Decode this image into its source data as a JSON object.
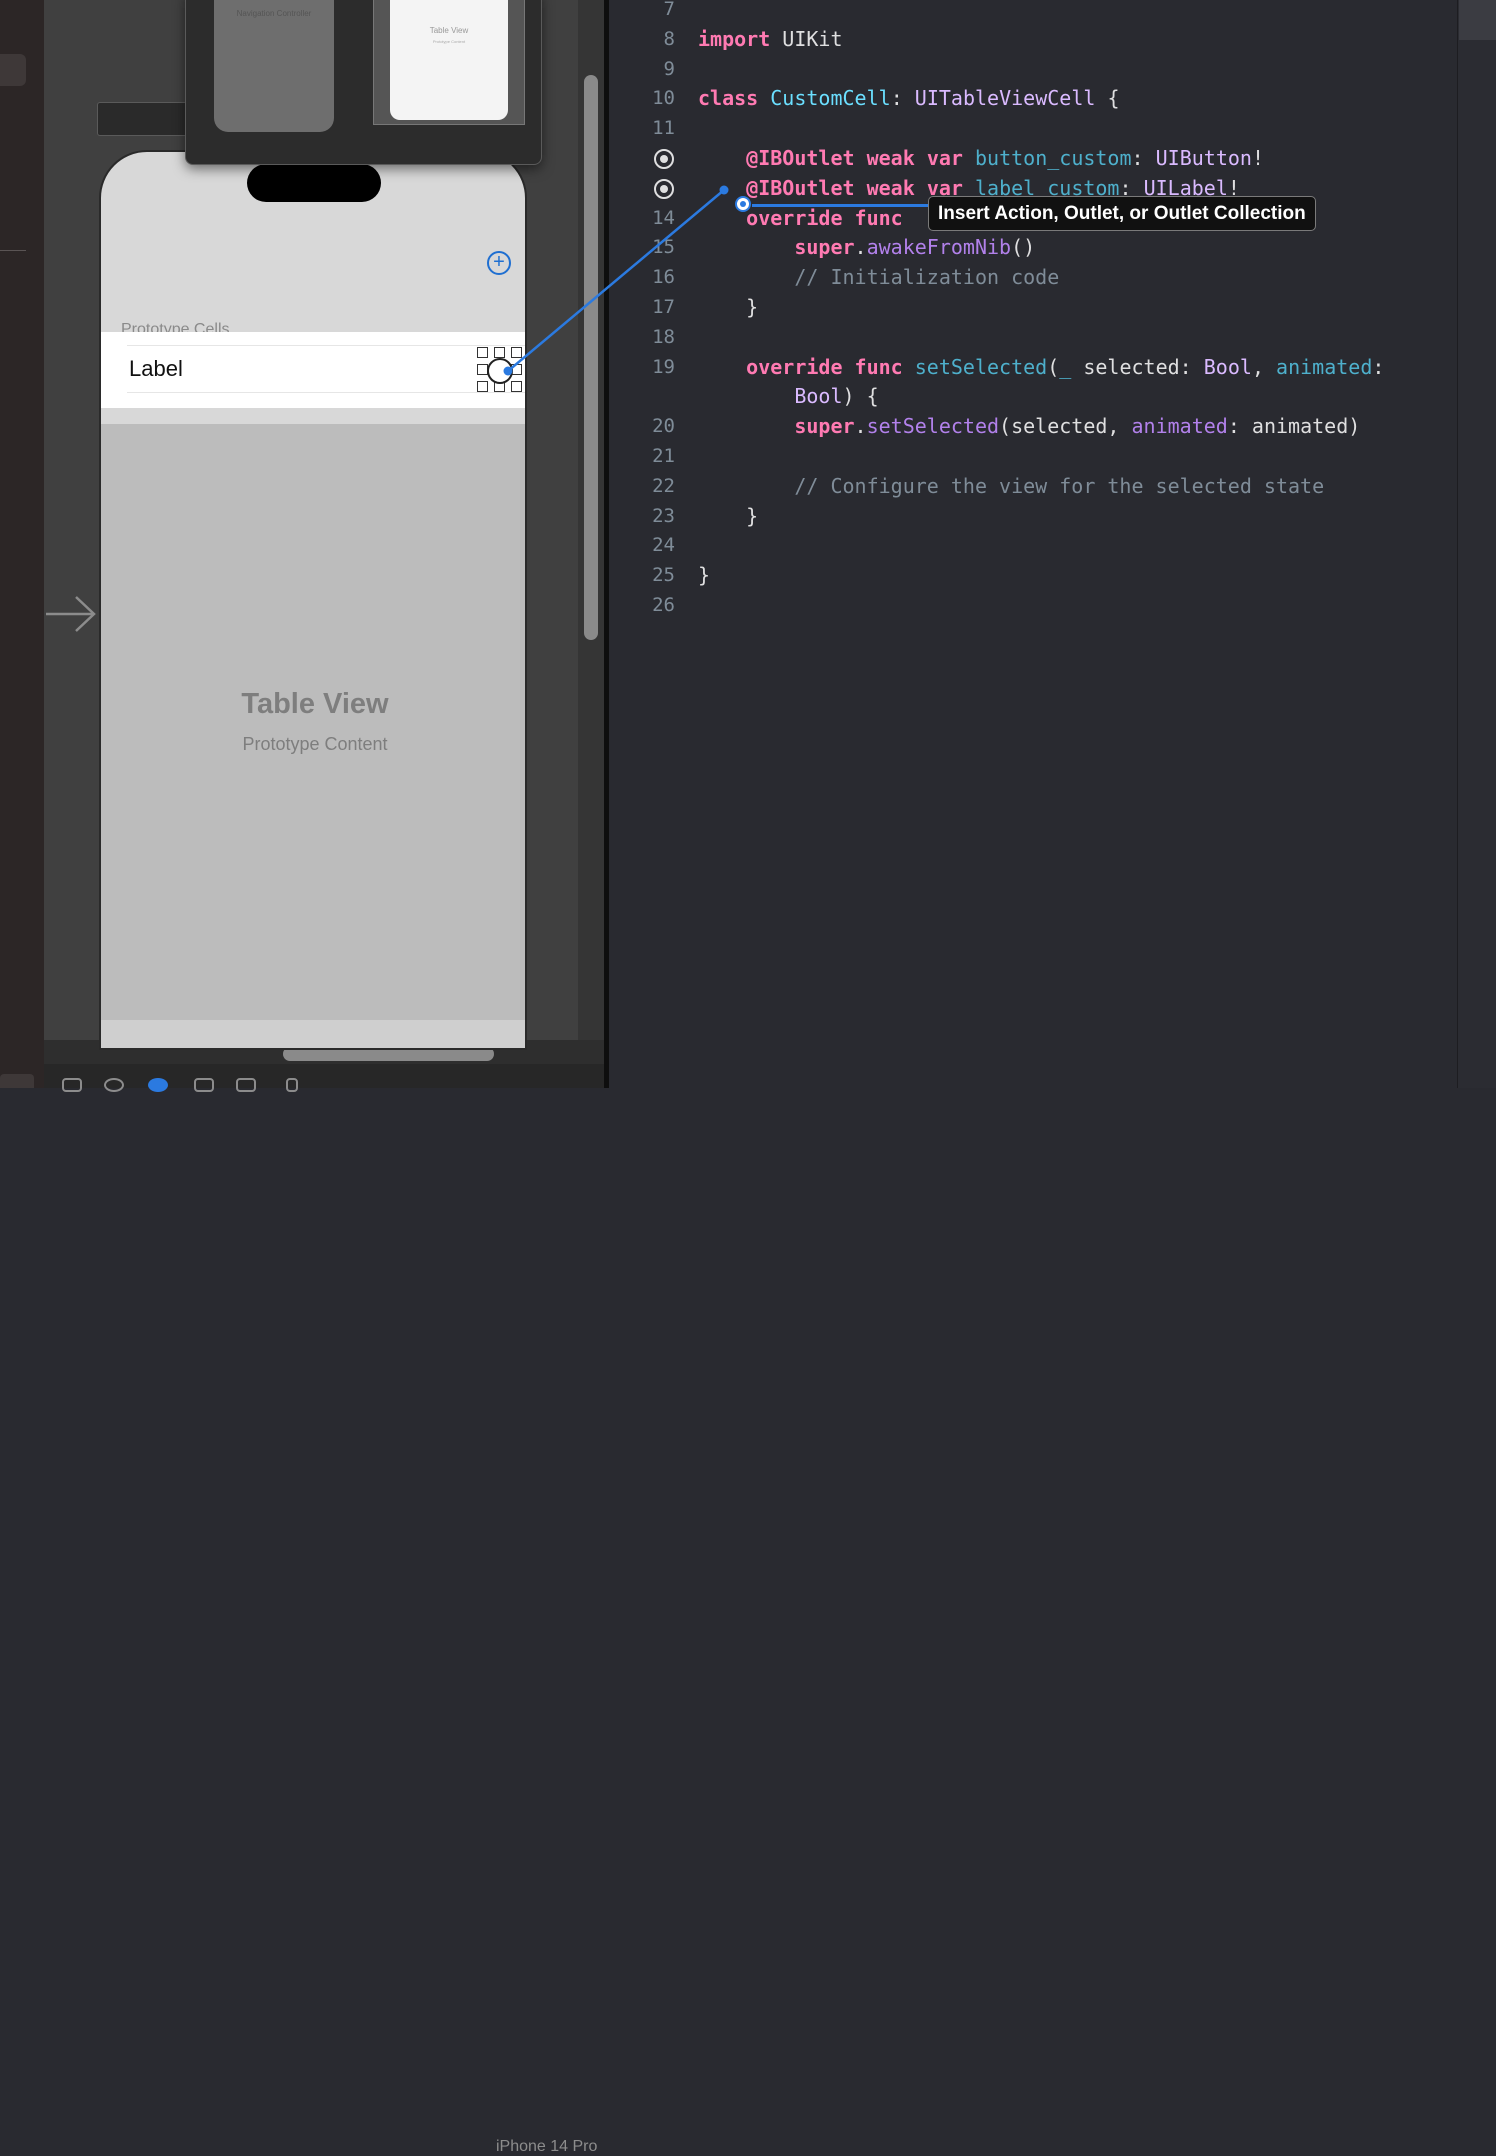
{
  "storyboard": {
    "mini_scenes": [
      {
        "label": "Navigation Controller"
      },
      {
        "label": "Table View",
        "sublabel": "Prototype Content"
      }
    ],
    "section_header": "Prototype Cells",
    "cell_label": "Label",
    "table_view_title": "Table View",
    "table_view_subtitle": "Prototype Content",
    "add_button_glyph": "+",
    "device_name": "iPhone 14 Pro"
  },
  "editor": {
    "lines": [
      {
        "num": "7",
        "tokens": []
      },
      {
        "num": "8",
        "tokens": [
          {
            "t": "import",
            "c": "kw"
          },
          {
            "t": " UIKit",
            "c": ""
          }
        ]
      },
      {
        "num": "9",
        "tokens": []
      },
      {
        "num": "10",
        "tokens": [
          {
            "t": "class",
            "c": "kw"
          },
          {
            "t": " ",
            "c": ""
          },
          {
            "t": "CustomCell",
            "c": "cls"
          },
          {
            "t": ": ",
            "c": ""
          },
          {
            "t": "UITableViewCell",
            "c": "typ"
          },
          {
            "t": " {",
            "c": ""
          }
        ]
      },
      {
        "num": "11",
        "tokens": []
      },
      {
        "num": "",
        "outlet": true,
        "tokens": [
          {
            "t": "    ",
            "c": ""
          },
          {
            "t": "@IBOutlet",
            "c": "kw"
          },
          {
            "t": " ",
            "c": ""
          },
          {
            "t": "weak",
            "c": "kw"
          },
          {
            "t": " ",
            "c": ""
          },
          {
            "t": "var",
            "c": "kw"
          },
          {
            "t": " ",
            "c": ""
          },
          {
            "t": "button_custom",
            "c": "prop"
          },
          {
            "t": ": ",
            "c": ""
          },
          {
            "t": "UIButton",
            "c": "typ"
          },
          {
            "t": "!",
            "c": ""
          }
        ]
      },
      {
        "num": "",
        "outlet": true,
        "tokens": [
          {
            "t": "    ",
            "c": ""
          },
          {
            "t": "@IBOutlet",
            "c": "kw"
          },
          {
            "t": " ",
            "c": ""
          },
          {
            "t": "weak",
            "c": "kw"
          },
          {
            "t": " ",
            "c": ""
          },
          {
            "t": "var",
            "c": "kw"
          },
          {
            "t": " ",
            "c": ""
          },
          {
            "t": "label_custom",
            "c": "prop"
          },
          {
            "t": ": ",
            "c": ""
          },
          {
            "t": "UILabel",
            "c": "typ"
          },
          {
            "t": "!",
            "c": ""
          }
        ]
      },
      {
        "num": "14",
        "tokens": [
          {
            "t": "    ",
            "c": ""
          },
          {
            "t": "override",
            "c": "kw"
          },
          {
            "t": " ",
            "c": ""
          },
          {
            "t": "func",
            "c": "kw"
          }
        ]
      },
      {
        "num": "15",
        "tokens": [
          {
            "t": "        ",
            "c": ""
          },
          {
            "t": "super",
            "c": "kw"
          },
          {
            "t": ".",
            "c": ""
          },
          {
            "t": "awakeFromNib",
            "c": "call"
          },
          {
            "t": "()",
            "c": ""
          }
        ]
      },
      {
        "num": "16",
        "tokens": [
          {
            "t": "        // Initialization code",
            "c": "com"
          }
        ]
      },
      {
        "num": "17",
        "tokens": [
          {
            "t": "    }",
            "c": ""
          }
        ]
      },
      {
        "num": "18",
        "tokens": []
      },
      {
        "num": "19",
        "tokens": [
          {
            "t": "    ",
            "c": ""
          },
          {
            "t": "override",
            "c": "kw"
          },
          {
            "t": " ",
            "c": ""
          },
          {
            "t": "func",
            "c": "kw"
          },
          {
            "t": " ",
            "c": ""
          },
          {
            "t": "setSelected",
            "c": "prop"
          },
          {
            "t": "(",
            "c": ""
          },
          {
            "t": "_",
            "c": "prop"
          },
          {
            "t": " selected: ",
            "c": ""
          },
          {
            "t": "Bool",
            "c": "typ"
          },
          {
            "t": ", ",
            "c": ""
          },
          {
            "t": "animated",
            "c": "prop"
          },
          {
            "t": ":",
            "c": ""
          }
        ]
      },
      {
        "num": "",
        "tokens": [
          {
            "t": "        ",
            "c": ""
          },
          {
            "t": "Bool",
            "c": "typ"
          },
          {
            "t": ") {",
            "c": ""
          }
        ]
      },
      {
        "num": "20",
        "tokens": [
          {
            "t": "        ",
            "c": ""
          },
          {
            "t": "super",
            "c": "kw"
          },
          {
            "t": ".",
            "c": ""
          },
          {
            "t": "setSelected",
            "c": "call"
          },
          {
            "t": "(selected, ",
            "c": ""
          },
          {
            "t": "animated",
            "c": "call"
          },
          {
            "t": ": animated)",
            "c": ""
          }
        ]
      },
      {
        "num": "21",
        "tokens": []
      },
      {
        "num": "22",
        "tokens": [
          {
            "t": "        // Configure the view for the selected state",
            "c": "com"
          }
        ]
      },
      {
        "num": "23",
        "tokens": [
          {
            "t": "    }",
            "c": ""
          }
        ]
      },
      {
        "num": "24",
        "tokens": []
      },
      {
        "num": "25",
        "tokens": [
          {
            "t": "}",
            "c": ""
          }
        ]
      },
      {
        "num": "26",
        "tokens": []
      }
    ],
    "tooltip": "Insert Action, Outlet, or Outlet Collection"
  },
  "colors": {
    "accent_blue": "#2b7ae0",
    "keyword": "#ff7ab2",
    "type": "#dabaff",
    "comment": "#7f8c98"
  }
}
